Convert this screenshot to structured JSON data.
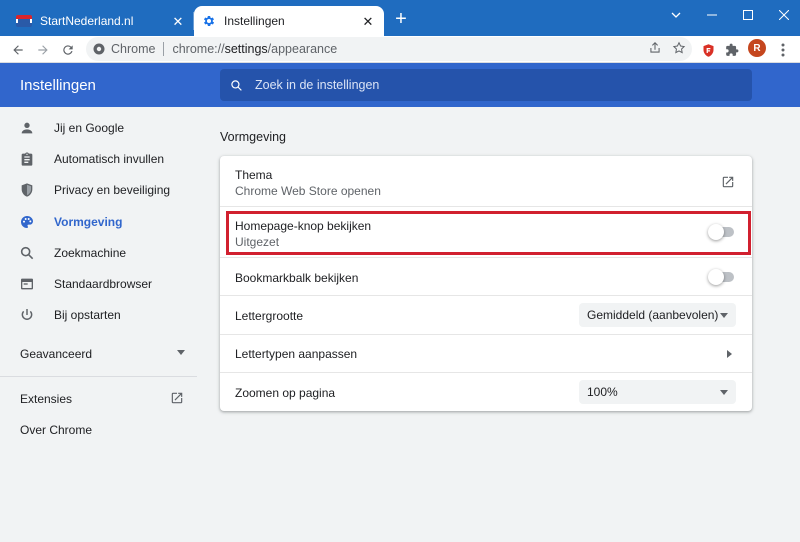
{
  "browser": {
    "tabs": [
      {
        "title": "StartNederland.nl",
        "favicon": "startnederland-favicon",
        "active": false
      },
      {
        "title": "Instellingen",
        "favicon": "settings-gear-icon",
        "active": true
      }
    ],
    "omnibox": {
      "chip": "Chrome",
      "url_scheme": "chrome://",
      "url_host": "settings",
      "url_path": "/appearance"
    },
    "profile_initial": "R"
  },
  "settings": {
    "header_title": "Instellingen",
    "search_placeholder": "Zoek in de instellingen",
    "nav": [
      {
        "label": "Jij en Google",
        "icon": "person-icon"
      },
      {
        "label": "Automatisch invullen",
        "icon": "clipboard-icon"
      },
      {
        "label": "Privacy en beveiliging",
        "icon": "shield-icon"
      },
      {
        "label": "Vormgeving",
        "icon": "palette-icon",
        "active": true
      },
      {
        "label": "Zoekmachine",
        "icon": "search-icon"
      },
      {
        "label": "Standaardbrowser",
        "icon": "browser-window-icon"
      },
      {
        "label": "Bij opstarten",
        "icon": "power-icon"
      }
    ],
    "advanced_label": "Geavanceerd",
    "extensions_label": "Extensies",
    "about_label": "Over Chrome",
    "section_title": "Vormgeving",
    "rows": {
      "theme": {
        "label": "Thema",
        "sub": "Chrome Web Store openen"
      },
      "homepage": {
        "label": "Homepage-knop bekijken",
        "sub": "Uitgezet",
        "enabled": false
      },
      "bookmarks": {
        "label": "Bookmarkbalk bekijken",
        "enabled": false
      },
      "fontsize": {
        "label": "Lettergrootte",
        "value": "Gemiddeld (aanbevolen)"
      },
      "fonts": {
        "label": "Lettertypen aanpassen"
      },
      "zoom": {
        "label": "Zoomen op pagina",
        "value": "100%"
      }
    }
  },
  "colors": {
    "titlebar": "#1f6cbf",
    "settings_header": "#3166cc",
    "accent": "#3166cc",
    "highlight_box": "#d1202f"
  }
}
